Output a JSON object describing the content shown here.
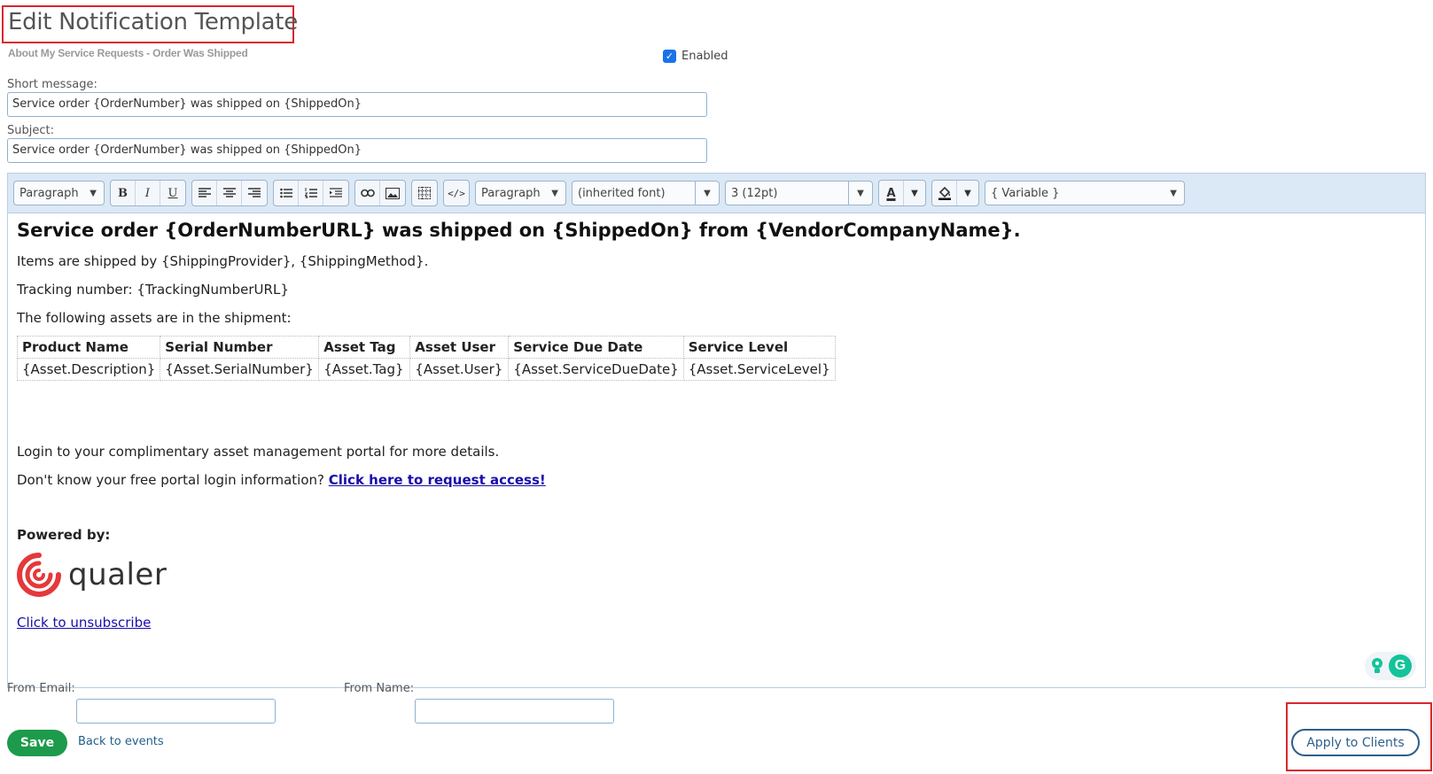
{
  "header": {
    "title": "Edit Notification Template",
    "subtitle": "About My Service Requests - Order Was Shipped",
    "enabled_label": "Enabled",
    "enabled_checked": true
  },
  "short_message": {
    "label": "Short message:",
    "value": "Service order {OrderNumber} was shipped on {ShippedOn}"
  },
  "subject": {
    "label": "Subject:",
    "value": "Service order {OrderNumber} was shipped on {ShippedOn}"
  },
  "toolbar": {
    "format_select": "Paragraph",
    "bold": "B",
    "italic": "I",
    "underline": "U",
    "block_select": "Paragraph",
    "font_select": "(inherited font)",
    "size_select": "3 (12pt)",
    "font_color_glyph": "A",
    "variable_select": "{ Variable }"
  },
  "body": {
    "heading": "Service order {OrderNumberURL} was shipped on {ShippedOn} from {VendorCompanyName}.",
    "line1": "Items are shipped by {ShippingProvider}, {ShippingMethod}.",
    "line2": "Tracking number: {TrackingNumberURL}",
    "line3": "The following assets are in the shipment:",
    "table": {
      "headers": [
        "Product Name",
        "Serial Number",
        "Asset Tag",
        "Asset User",
        "Service Due Date",
        "Service Level"
      ],
      "row": [
        "{Asset.Description}",
        "{Asset.SerialNumber}",
        "{Asset.Tag}",
        "{Asset.User}",
        "{Asset.ServiceDueDate}",
        "{Asset.ServiceLevel}"
      ]
    },
    "login_text": "Login to your complimentary asset management portal for more details.",
    "portal_text": "Don't know your free portal login information?",
    "portal_link": "Click here to request access!",
    "powered_by": "Powered by:",
    "logo_text": "qualer",
    "unsubscribe": "Click to unsubscribe"
  },
  "footer": {
    "from_email_label": "From Email:",
    "from_email_value": "",
    "from_name_label": "From Name:",
    "from_name_value": "",
    "save_label": "Save",
    "back_label": "Back to events",
    "apply_label": "Apply to Clients"
  },
  "colors": {
    "accent_red": "#d9272e",
    "save_green": "#1d9a4b",
    "link_blue": "#1a0dab",
    "logo_red": "#e5383b"
  }
}
